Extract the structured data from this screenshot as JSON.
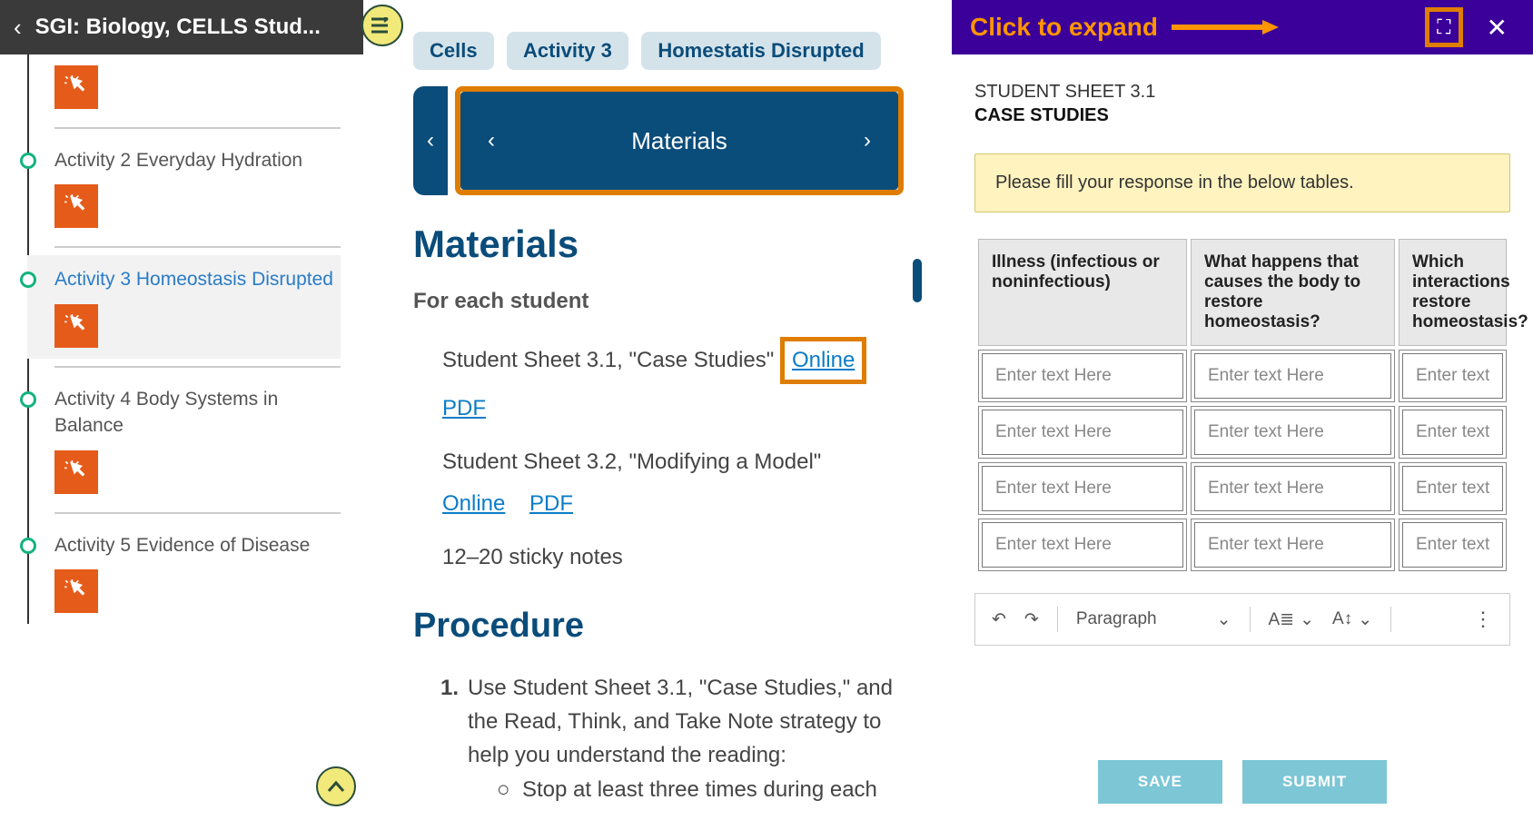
{
  "topbar": {
    "title": "SGI: Biology, CELLS Stud..."
  },
  "sidebar": {
    "items": [
      {
        "title": ""
      },
      {
        "title": "Activity 2 Everyday Hydration"
      },
      {
        "title": "Activity 3 Homeostasis Disrupted",
        "active": true
      },
      {
        "title": "Activity 4 Body Systems in Balance"
      },
      {
        "title": "Activity 5 Evidence of Disease"
      }
    ]
  },
  "breadcrumbs": [
    "Cells",
    "Activity 3",
    "Homestatis Disrupted"
  ],
  "navpill": "Materials",
  "content": {
    "heading": "Materials",
    "subhead": "For each student",
    "mat1_text": "Student Sheet 3.1, \"Case Studies\"",
    "mat1_online": "Online",
    "mat1_pdf": "PDF",
    "mat2_text": "Student Sheet 3.2, \"Modifying a Model\"",
    "mat2_online": "Online",
    "mat2_pdf": "PDF",
    "mat3_text": "12–20 sticky notes",
    "proc_heading": "Procedure",
    "proc1_num": "1.",
    "proc1": "Use Student Sheet 3.1, \"Case Studies,\" and the Read, Think, and Take Note strategy to help you understand the reading:",
    "proc1a": "Stop at least three times during each"
  },
  "right": {
    "expand_label": "Click to expand",
    "sheet_line1": "STUDENT SHEET 3.1",
    "sheet_line2": "CASE STUDIES",
    "instruction": "Please fill your response in the below tables.",
    "table": {
      "headers": [
        "Illness (infectious or noninfectious)",
        "What happens that causes the body to restore homeostasis?",
        "Which interactions restore homeostasis?"
      ],
      "placeholder": "Enter text Here",
      "rows": 4
    },
    "toolbar": {
      "paragraph": "Paragraph"
    },
    "buttons": {
      "save": "SAVE",
      "submit": "SUBMIT"
    }
  }
}
